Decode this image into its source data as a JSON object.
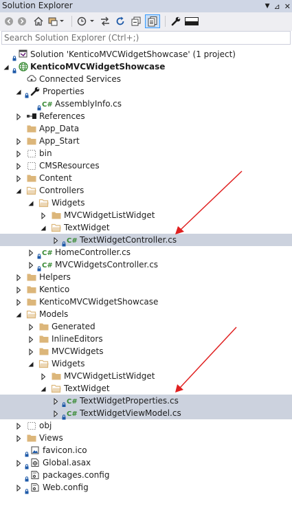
{
  "window": {
    "title": "Solution Explorer",
    "pin_glyph": "⊿",
    "close_glyph": "✕"
  },
  "search": {
    "placeholder": "Search Solution Explorer (Ctrl+;)"
  },
  "colors": {
    "selection": "#ccd2de",
    "folder": "#dcb67a",
    "arrow": "#e02020",
    "csharp": "#388a34"
  },
  "tree": [
    {
      "label": "Solution 'KenticoMVCWidgetShowcase' (1 project)",
      "level": 0,
      "icon": "solution-icon",
      "expander": "none",
      "lock": true
    },
    {
      "label": "KenticoMVCWidgetShowcase",
      "level": 0,
      "icon": "web-project-icon",
      "expander": "open",
      "lock": true,
      "bold": true
    },
    {
      "label": "Connected Services",
      "level": 1,
      "icon": "connected-services-icon",
      "expander": "none"
    },
    {
      "label": "Properties",
      "level": 1,
      "icon": "wrench-icon",
      "expander": "open",
      "lock": true
    },
    {
      "label": "AssemblyInfo.cs",
      "level": 2,
      "icon": "csharp-file-icon",
      "expander": "none",
      "lock": true
    },
    {
      "label": "References",
      "level": 1,
      "icon": "references-icon",
      "expander": "closed"
    },
    {
      "label": "App_Data",
      "level": 1,
      "icon": "folder-icon",
      "expander": "none"
    },
    {
      "label": "App_Start",
      "level": 1,
      "icon": "folder-icon",
      "expander": "closed"
    },
    {
      "label": "bin",
      "level": 1,
      "icon": "folder-dashed-icon",
      "expander": "closed"
    },
    {
      "label": "CMSResources",
      "level": 1,
      "icon": "folder-dashed-icon",
      "expander": "closed"
    },
    {
      "label": "Content",
      "level": 1,
      "icon": "folder-icon",
      "expander": "closed"
    },
    {
      "label": "Controllers",
      "level": 1,
      "icon": "folder-open-icon",
      "expander": "open"
    },
    {
      "label": "Widgets",
      "level": 2,
      "icon": "folder-open-icon",
      "expander": "open"
    },
    {
      "label": "MVCWidgetListWidget",
      "level": 3,
      "icon": "folder-icon",
      "expander": "closed"
    },
    {
      "label": "TextWidget",
      "level": 3,
      "icon": "folder-open-icon",
      "expander": "open"
    },
    {
      "label": "TextWidgetController.cs",
      "level": 4,
      "icon": "csharp-file-icon",
      "expander": "closed",
      "lock": true,
      "selected": true
    },
    {
      "label": "HomeController.cs",
      "level": 2,
      "icon": "csharp-file-icon",
      "expander": "closed",
      "lock": true
    },
    {
      "label": "MVCWidgetsController.cs",
      "level": 2,
      "icon": "csharp-file-icon",
      "expander": "closed",
      "lock": true
    },
    {
      "label": "Helpers",
      "level": 1,
      "icon": "folder-icon",
      "expander": "closed"
    },
    {
      "label": "Kentico",
      "level": 1,
      "icon": "folder-icon",
      "expander": "closed"
    },
    {
      "label": "KenticoMVCWidgetShowcase",
      "level": 1,
      "icon": "folder-icon",
      "expander": "closed"
    },
    {
      "label": "Models",
      "level": 1,
      "icon": "folder-open-icon",
      "expander": "open"
    },
    {
      "label": "Generated",
      "level": 2,
      "icon": "folder-icon",
      "expander": "closed"
    },
    {
      "label": "InlineEditors",
      "level": 2,
      "icon": "folder-icon",
      "expander": "closed"
    },
    {
      "label": "MVCWidgets",
      "level": 2,
      "icon": "folder-icon",
      "expander": "closed"
    },
    {
      "label": "Widgets",
      "level": 2,
      "icon": "folder-open-icon",
      "expander": "open"
    },
    {
      "label": "MVCWidgetListWidget",
      "level": 3,
      "icon": "folder-icon",
      "expander": "closed"
    },
    {
      "label": "TextWidget",
      "level": 3,
      "icon": "folder-open-icon",
      "expander": "open"
    },
    {
      "label": "TextWidgetProperties.cs",
      "level": 4,
      "icon": "csharp-file-icon",
      "expander": "closed",
      "lock": true,
      "selected": true
    },
    {
      "label": "TextWidgetViewModel.cs",
      "level": 4,
      "icon": "csharp-file-icon",
      "expander": "closed",
      "lock": true,
      "selected": true
    },
    {
      "label": "obj",
      "level": 1,
      "icon": "folder-dashed-icon",
      "expander": "closed"
    },
    {
      "label": "Views",
      "level": 1,
      "icon": "folder-icon",
      "expander": "closed"
    },
    {
      "label": "favicon.ico",
      "level": 1,
      "icon": "image-file-icon",
      "expander": "none",
      "lock": true
    },
    {
      "label": "Global.asax",
      "level": 1,
      "icon": "asax-file-icon",
      "expander": "closed",
      "lock": true
    },
    {
      "label": "packages.config",
      "level": 1,
      "icon": "config-file-icon",
      "expander": "none",
      "lock": true
    },
    {
      "label": "Web.config",
      "level": 1,
      "icon": "config-file-icon",
      "expander": "closed",
      "lock": true
    }
  ]
}
